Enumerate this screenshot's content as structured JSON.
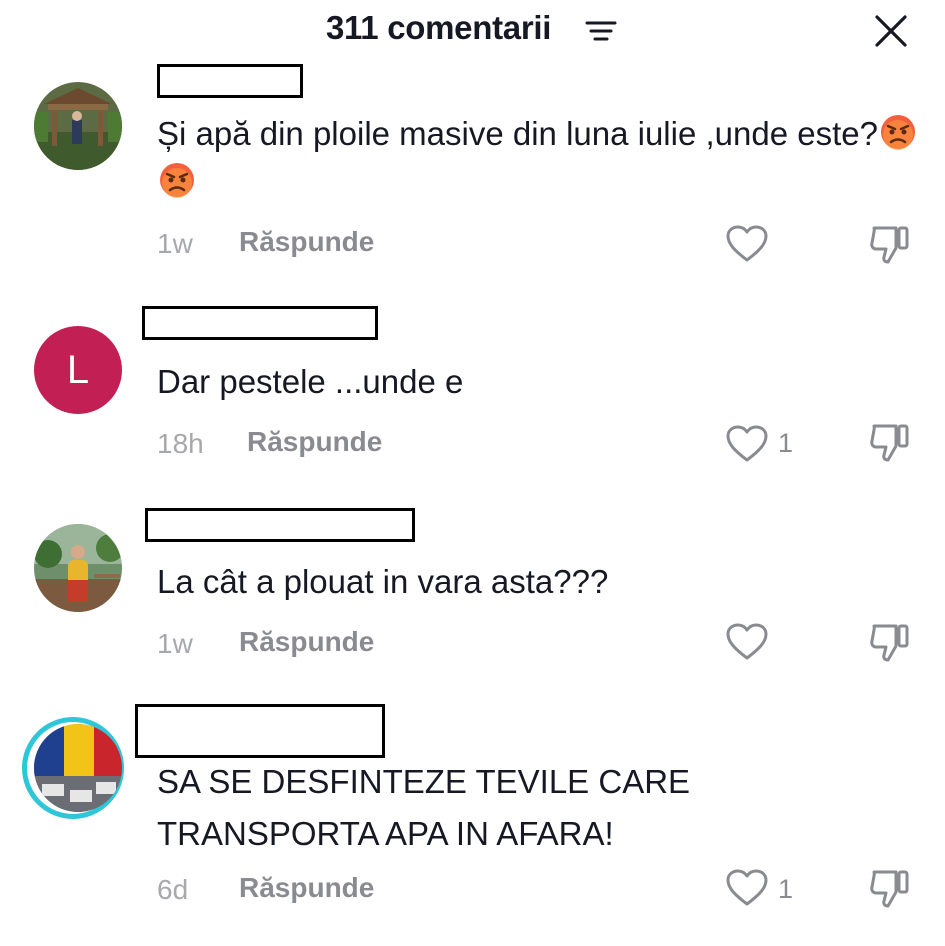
{
  "header": {
    "title": "311 comentarii",
    "filter_icon": "filter-lines-icon",
    "close_icon": "close-x-icon"
  },
  "reply_label": "Răspunde",
  "comments": [
    {
      "text": "Și apă din ploile masive din luna iulie ,unde este?",
      "emojis": [
        "angry-face",
        "angry-face"
      ],
      "time": "1w",
      "likes": "",
      "avatar": "photo-man-gazebo"
    },
    {
      "text": "Dar pestele ...unde e",
      "time": "18h",
      "likes": "1",
      "avatar_letter": "L",
      "avatar_color": "#c21f55"
    },
    {
      "text": "La cât a plouat in vara asta???",
      "time": "1w",
      "likes": "",
      "avatar": "photo-woman-garden"
    },
    {
      "text": "SA SE DESFINTEZE TEVILE CARE TRANSPORTA APA IN AFARA!",
      "time": "6d",
      "likes": "1",
      "avatar": "photo-flag-protest",
      "avatar_ring_color": "#2ec6d8"
    }
  ],
  "colors": {
    "text_primary": "#161823",
    "text_secondary": "#8a8b91",
    "time_text": "#a7a8ad"
  }
}
